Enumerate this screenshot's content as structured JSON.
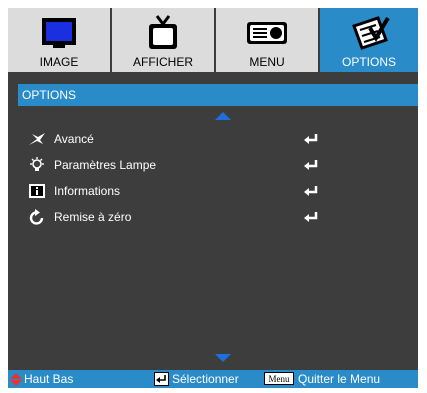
{
  "tabs": [
    {
      "label": "IMAGE",
      "icon": "monitor-icon"
    },
    {
      "label": "AFFICHER",
      "icon": "tv-icon"
    },
    {
      "label": "MENU",
      "icon": "projector-icon"
    },
    {
      "label": "OPTIONS",
      "icon": "checklist-icon",
      "active": true
    }
  ],
  "panel": {
    "title": "OPTIONS",
    "items": [
      {
        "label": "Avancé",
        "icon": "star-icon"
      },
      {
        "label": "Paramètres Lampe",
        "icon": "lamp-icon"
      },
      {
        "label": "Informations",
        "icon": "info-icon"
      },
      {
        "label": "Remise à zéro",
        "icon": "reset-icon"
      }
    ]
  },
  "status": {
    "nav": "Haut Bas",
    "select": "Sélectionner",
    "menu_key": "Menu",
    "quit": "Quitter le Menu"
  },
  "colors": {
    "accent": "#2a8bc9",
    "panel": "#3d3d3d",
    "tab": "#dcdcdc",
    "arrow": "#1e6fd9",
    "nav_red": "#e4342d"
  }
}
